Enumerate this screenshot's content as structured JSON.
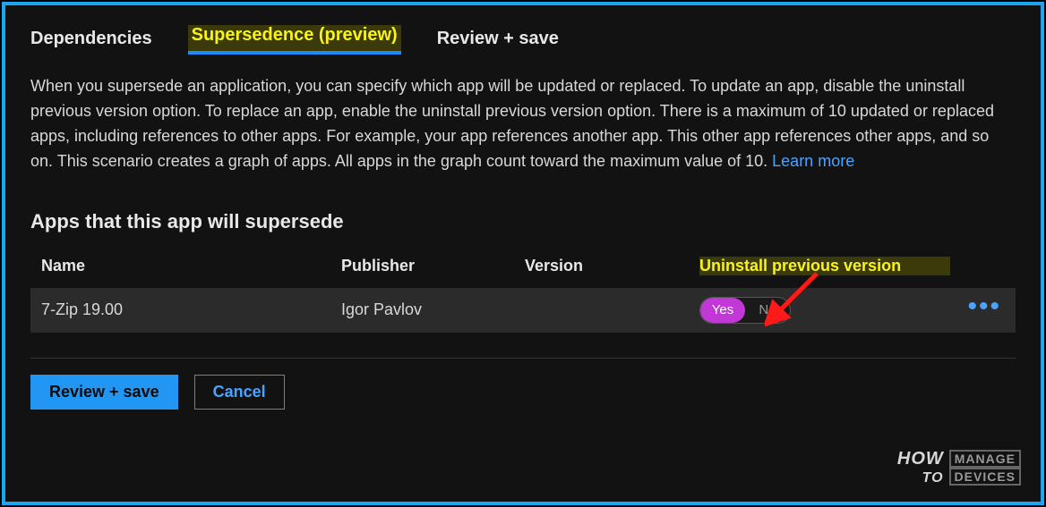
{
  "tabs": {
    "dependencies": "Dependencies",
    "supersedence": "Supersedence (preview)",
    "review": "Review + save"
  },
  "description": {
    "text": "When you supersede an application, you can specify which app will be updated or replaced. To update an app, disable the uninstall previous version option. To replace an app, enable the uninstall previous version option. There is a maximum of 10 updated or replaced apps, including references to other apps. For example, your app references another app. This other app references other apps, and so on. This scenario creates a graph of apps. All apps in the graph count toward the maximum value of 10.",
    "learn_more": "Learn more"
  },
  "section_title": "Apps that this app will supersede",
  "columns": {
    "name": "Name",
    "publisher": "Publisher",
    "version": "Version",
    "uninstall": "Uninstall previous version"
  },
  "row": {
    "name": "7-Zip 19.00",
    "publisher": "Igor Pavlov",
    "version": "",
    "toggle_yes": "Yes",
    "toggle_no": "No"
  },
  "buttons": {
    "review_save": "Review + save",
    "cancel": "Cancel"
  },
  "watermark": {
    "how": "HOW",
    "manage": "MANAGE",
    "to": "TO",
    "devices": "DEVICES"
  }
}
